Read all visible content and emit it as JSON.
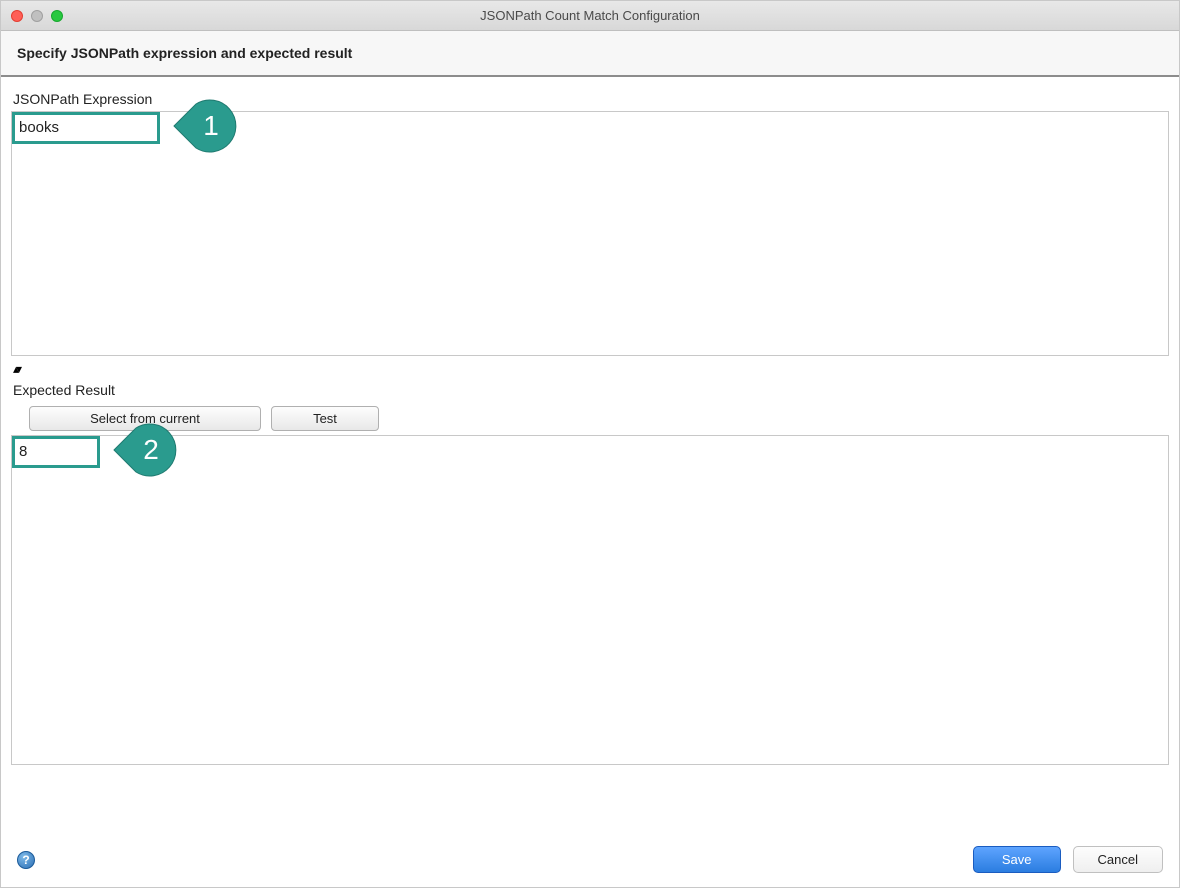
{
  "window": {
    "title": "JSONPath Count Match Configuration"
  },
  "header": {
    "instruction": "Specify JSONPath expression and expected result"
  },
  "expression": {
    "label": "JSONPath Expression",
    "value": "books"
  },
  "splitter": {
    "arrows": "▴▾"
  },
  "result": {
    "label": "Expected Result",
    "select_button": "Select from current",
    "test_button": "Test",
    "value": "8"
  },
  "callouts": {
    "one": "1",
    "two": "2"
  },
  "footer": {
    "help_label": "?",
    "save": "Save",
    "cancel": "Cancel"
  },
  "colors": {
    "callout_fill": "#2a9b8e",
    "save_button": "#2b7de0"
  }
}
